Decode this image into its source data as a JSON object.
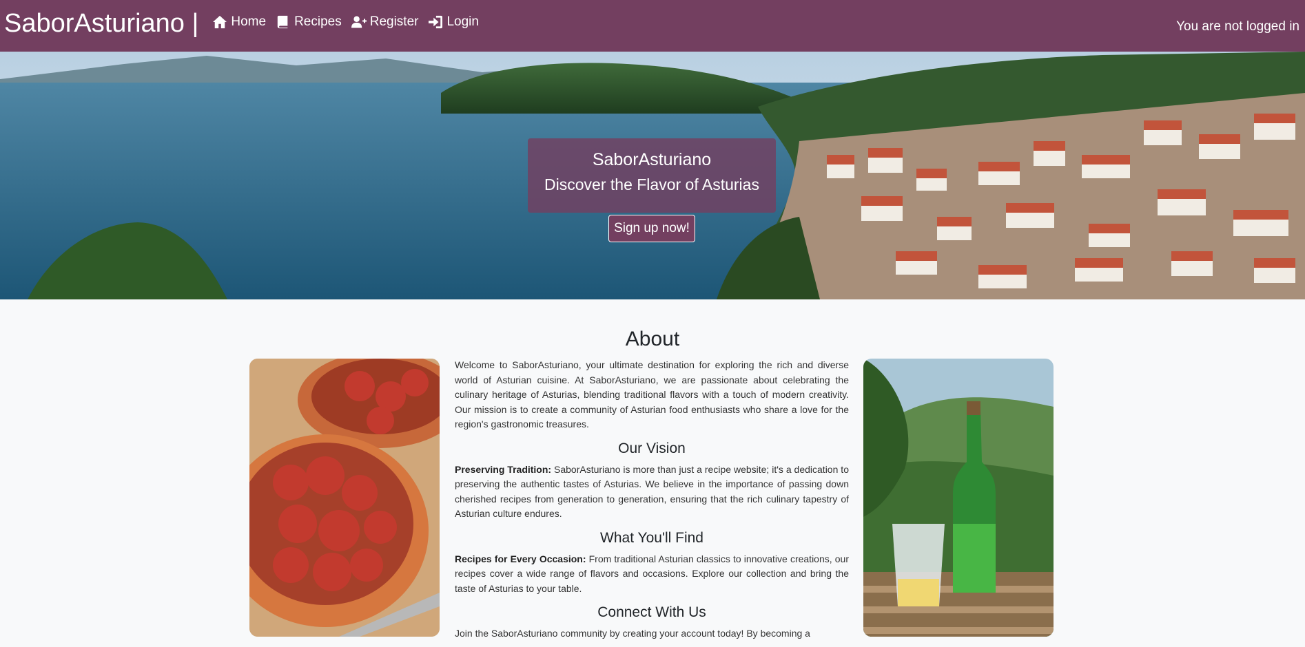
{
  "navbar": {
    "brand": "SaborAsturiano |",
    "links": [
      {
        "label": "Home",
        "icon": "home-icon"
      },
      {
        "label": "Recipes",
        "icon": "book-icon"
      },
      {
        "label": "Register",
        "icon": "user-plus-icon"
      },
      {
        "label": "Login",
        "icon": "sign-in-icon"
      }
    ],
    "status": "You are not logged in"
  },
  "hero": {
    "title": "SaborAsturiano",
    "subtitle": "Discover the Flavor of Asturias",
    "cta": "Sign up now!"
  },
  "about": {
    "title": "About",
    "intro": "Welcome to SaborAsturiano, your ultimate destination for exploring the rich and diverse world of Asturian cuisine. At SaborAsturiano, we are passionate about celebrating the culinary heritage of Asturias, blending traditional flavors with a touch of modern creativity. Our mission is to create a community of Asturian food enthusiasts who share a love for the region's gastronomic treasures.",
    "sections": [
      {
        "heading": "Our Vision",
        "lead": "Preserving Tradition:",
        "text": " SaborAsturiano is more than just a recipe website; it's a dedication to preserving the authentic tastes of Asturias. We believe in the importance of passing down cherished recipes from generation to generation, ensuring that the rich culinary tapestry of Asturian culture endures."
      },
      {
        "heading": "What You'll Find",
        "lead": "Recipes for Every Occasion:",
        "text": " From traditional Asturian classics to innovative creations, our recipes cover a wide range of flavors and occasions. Explore our collection and bring the taste of Asturias to your table."
      },
      {
        "heading": "Connect With Us",
        "lead": "",
        "text": "Join the SaborAsturiano community by creating your account today! By becoming a"
      }
    ]
  },
  "colors": {
    "brand": "#733f60",
    "background": "#f8f9fa"
  }
}
